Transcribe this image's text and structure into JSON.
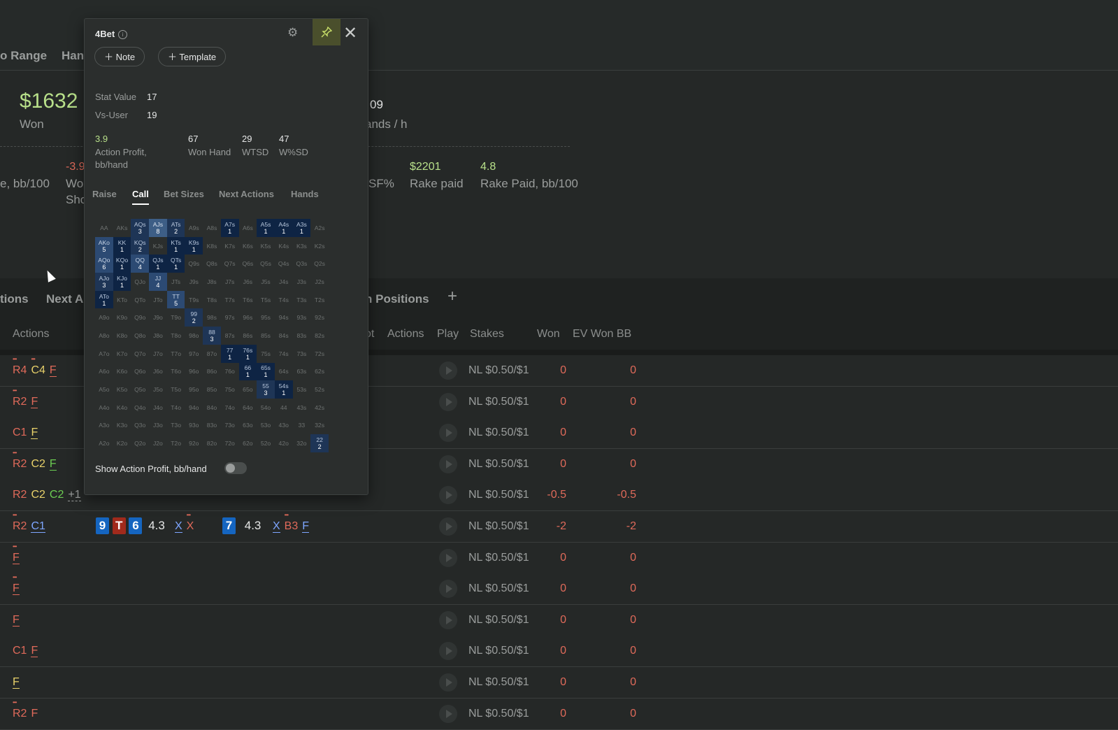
{
  "bg": {
    "tabs": [
      "o Range",
      "Han"
    ],
    "won_value": "$1632",
    "won_label": "Won",
    "hands_value": "09",
    "hands_label": "ands / h",
    "left_stat_label": "e, bb/100",
    "wo_value": "-3.9",
    "wo_label1": "Wo",
    "wo_label2": "Sho",
    "sf_label": "SF%",
    "rake_value": "$2201",
    "rake_label": "Rake paid",
    "rake_bb_value": "4.8",
    "rake_bb_label": "Rake Paid, bb/100",
    "subtabs": [
      "tions",
      "Next A",
      "n Positions",
      "+"
    ],
    "col_actions_left": "Actions",
    "columns": [
      "ot",
      "Actions",
      "Play",
      "Stakes",
      "Won",
      "EV Won BB"
    ]
  },
  "rows": [
    {
      "stakes": "NL $0.50/$1",
      "won": "0",
      "ev": "0"
    },
    {
      "stakes": "NL $0.50/$1",
      "won": "0",
      "ev": "0"
    },
    {
      "stakes": "NL $0.50/$1",
      "won": "0",
      "ev": "0"
    },
    {
      "stakes": "NL $0.50/$1",
      "won": "0",
      "ev": "0"
    },
    {
      "stakes": "NL $0.50/$1",
      "won": "-0.5",
      "ev": "-0.5",
      "extra": "+1"
    },
    {
      "stakes": "NL $0.50/$1",
      "won": "-2",
      "ev": "-2",
      "board": [
        "9",
        "T",
        "6"
      ],
      "pot1": "4.3",
      "turn": "7",
      "pot2": "4.3"
    },
    {
      "stakes": "NL $0.50/$1",
      "won": "0",
      "ev": "0"
    },
    {
      "stakes": "NL $0.50/$1",
      "won": "0",
      "ev": "0"
    },
    {
      "stakes": "NL $0.50/$1",
      "won": "0",
      "ev": "0"
    },
    {
      "stakes": "NL $0.50/$1",
      "won": "0",
      "ev": "0"
    },
    {
      "stakes": "NL $0.50/$1",
      "won": "0",
      "ev": "0"
    },
    {
      "stakes": "NL $0.50/$1",
      "won": "0",
      "ev": "0"
    }
  ],
  "popup": {
    "title": "4Bet",
    "note_label": "Note",
    "template_label": "Template",
    "stat_value_label": "Stat Value",
    "stat_value": "17",
    "vs_user_label": "Vs-User",
    "vs_user": "19",
    "action_profit": "3.9",
    "action_profit_label": "Action Profit, bb/hand",
    "won_hand": "67",
    "won_hand_label": "Won Hand",
    "wtsd": "29",
    "wtsd_label": "WTSD",
    "wsd": "47",
    "wsd_label": "W%SD",
    "tabs": [
      "Raise",
      "Call",
      "Bet Sizes",
      "Next Actions",
      "Hands"
    ],
    "toggle_label": "Show Action Profit, bb/hand"
  },
  "range_grid": [
    [
      "AA",
      "AKs",
      "AQs:3",
      "AJs:8",
      "ATs:2",
      "A9s",
      "A8s",
      "A7s:1",
      "A6s",
      "A5s:1",
      "A4s:1",
      "A3s:1",
      "A2s"
    ],
    [
      "AKo:5",
      "KK:1",
      "KQs:2",
      "KJs",
      "KTs:1",
      "K9s:1",
      "K8s",
      "K7s",
      "K6s",
      "K5s",
      "K4s",
      "K3s",
      "K2s"
    ],
    [
      "AQo:6",
      "KQo:1",
      "QQ:4",
      "QJs:1",
      "QTs:1",
      "Q9s",
      "Q8s",
      "Q7s",
      "Q6s",
      "Q5s",
      "Q4s",
      "Q3s",
      "Q2s"
    ],
    [
      "AJo:3",
      "KJo:1",
      "QJo",
      "JJ:4",
      "JTs",
      "J9s",
      "J8s",
      "J7s",
      "J6s",
      "J5s",
      "J4s",
      "J3s",
      "J2s"
    ],
    [
      "ATo:1",
      "KTo",
      "QTo",
      "JTo",
      "TT:5",
      "T9s",
      "T8s",
      "T7s",
      "T6s",
      "T5s",
      "T4s",
      "T3s",
      "T2s"
    ],
    [
      "A9o",
      "K9o",
      "Q9o",
      "J9o",
      "T9o",
      "99:2",
      "98s",
      "97s",
      "96s",
      "95s",
      "94s",
      "93s",
      "92s"
    ],
    [
      "A8o",
      "K8o",
      "Q8o",
      "J8o",
      "T8o",
      "98o",
      "88:3",
      "87s",
      "86s",
      "85s",
      "84s",
      "83s",
      "82s"
    ],
    [
      "A7o",
      "K7o",
      "Q7o",
      "J7o",
      "T7o",
      "97o",
      "87o",
      "77:1",
      "76s:1",
      "75s",
      "74s",
      "73s",
      "72s"
    ],
    [
      "A6o",
      "K6o",
      "Q6o",
      "J6o",
      "T6o",
      "96o",
      "86o",
      "76o",
      "66:1",
      "65s:1",
      "64s",
      "63s",
      "62s"
    ],
    [
      "A5o",
      "K5o",
      "Q5o",
      "J5o",
      "T5o",
      "95o",
      "85o",
      "75o",
      "65o",
      "55:3",
      "54s:1",
      "53s",
      "52s"
    ],
    [
      "A4o",
      "K4o",
      "Q4o",
      "J4o",
      "T4o",
      "94o",
      "84o",
      "74o",
      "64o",
      "54o",
      "44",
      "43s",
      "42s"
    ],
    [
      "A3o",
      "K3o",
      "Q3o",
      "J3o",
      "T3o",
      "93o",
      "83o",
      "73o",
      "63o",
      "53o",
      "43o",
      "33",
      "32s"
    ],
    [
      "A2o",
      "K2o",
      "Q2o",
      "J2o",
      "T2o",
      "92o",
      "82o",
      "72o",
      "62o",
      "52o",
      "42o",
      "32o",
      "22:2"
    ]
  ]
}
